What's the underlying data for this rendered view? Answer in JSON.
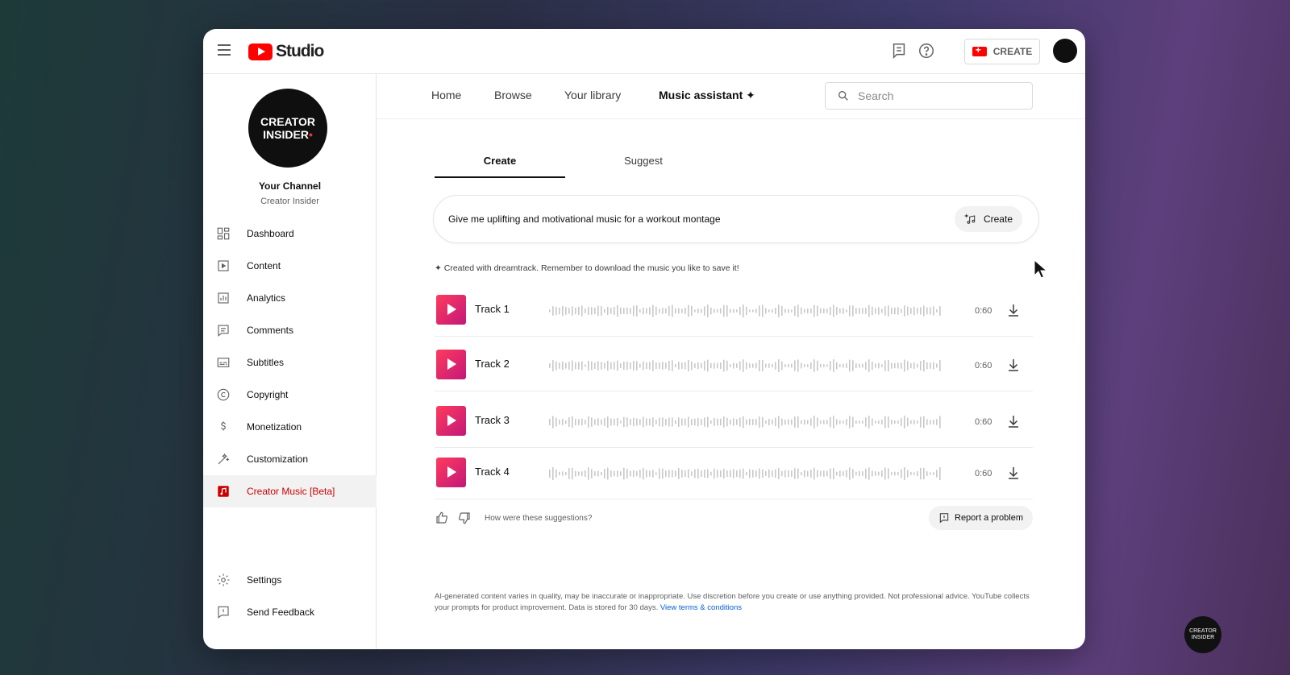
{
  "app": {
    "logo_text": "Studio"
  },
  "topbar": {
    "create_label": "CREATE"
  },
  "channel": {
    "avatar_line1": "CREATOR",
    "avatar_line2": "INSIDER",
    "title": "Your Channel",
    "name": "Creator Insider"
  },
  "sidebar": {
    "items": [
      {
        "label": "Dashboard",
        "icon": "dashboard-icon"
      },
      {
        "label": "Content",
        "icon": "content-icon"
      },
      {
        "label": "Analytics",
        "icon": "analytics-icon"
      },
      {
        "label": "Comments",
        "icon": "comments-icon"
      },
      {
        "label": "Subtitles",
        "icon": "subtitles-icon"
      },
      {
        "label": "Copyright",
        "icon": "copyright-icon"
      },
      {
        "label": "Monetization",
        "icon": "monetization-icon"
      },
      {
        "label": "Customization",
        "icon": "customization-icon"
      },
      {
        "label": "Creator Music [Beta]",
        "icon": "creator-music-icon",
        "active": true
      }
    ],
    "bottom": [
      {
        "label": "Settings",
        "icon": "settings-icon"
      },
      {
        "label": "Send Feedback",
        "icon": "feedback-icon"
      }
    ]
  },
  "main_nav": {
    "tabs": [
      "Home",
      "Browse",
      "Your library",
      "Music assistant"
    ],
    "active": "Music assistant",
    "search_placeholder": "Search"
  },
  "sub_tabs": {
    "create": "Create",
    "suggest": "Suggest",
    "active": "Create"
  },
  "prompt": {
    "text": "Give me uplifting and motivational music for a workout montage",
    "button": "Create"
  },
  "note": "Created with dreamtrack. Remember to download the music you like to save it!",
  "tracks": [
    {
      "name": "Track 1",
      "duration": "0:60"
    },
    {
      "name": "Track 2",
      "duration": "0:60"
    },
    {
      "name": "Track 3",
      "duration": "0:60"
    },
    {
      "name": "Track 4",
      "duration": "0:60"
    }
  ],
  "feedback": {
    "question": "How were these suggestions?",
    "report": "Report a problem"
  },
  "disclaimer": {
    "text": "AI-generated content varies in quality, may be inaccurate or inappropriate. Use discretion before you create or use anything provided. Not professional advice. YouTube collects your prompts for product improvement. Data is stored for 30 days.",
    "link": "View terms & conditions"
  },
  "colors": {
    "brand_red": "#ff0000",
    "active_red": "#cc0000",
    "play_gradient_start": "#ff3b5c",
    "play_gradient_end": "#c2187a",
    "link": "#065fd4"
  }
}
